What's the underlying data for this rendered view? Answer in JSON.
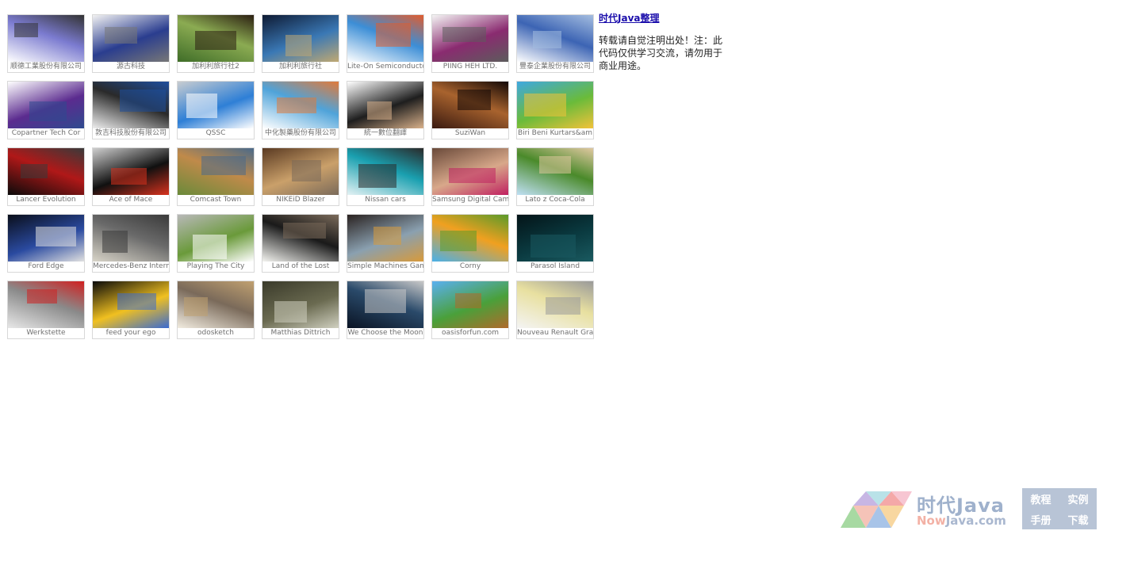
{
  "sidebar": {
    "title": "时代Java整理",
    "note": "转载请自觉注明出处！注：此代码仅供学习交流，请勿用于商业用途。"
  },
  "gallery": [
    {
      "caption": "顺德工業股份有限公司",
      "colors": [
        "#ffffff",
        "#7b7bd0",
        "#333333"
      ]
    },
    {
      "caption": "源古科技",
      "colors": [
        "#f2f2f2",
        "#2a3d8f",
        "#777777"
      ]
    },
    {
      "caption": "加利利旅行社2",
      "colors": [
        "#3f6d28",
        "#8bab52",
        "#2c1f12"
      ]
    },
    {
      "caption": "加利利旅行社",
      "colors": [
        "#0e1a33",
        "#3a78b5",
        "#c0a872"
      ]
    },
    {
      "caption": "Lite-On Semiconducto",
      "colors": [
        "#ffffff",
        "#3c8ed6",
        "#e05c2e"
      ]
    },
    {
      "caption": "PIING HEH LTD.",
      "colors": [
        "#f4f4f4",
        "#8a2b70",
        "#5c5c5c"
      ]
    },
    {
      "caption": "豐泰企業股份有限公司",
      "colors": [
        "#ffffff",
        "#3c64b4",
        "#a4bde0"
      ]
    },
    {
      "caption": "Copartner Tech Cor",
      "colors": [
        "#ffffff",
        "#5b2b8f",
        "#2e4b8f"
      ]
    },
    {
      "caption": "敦吉科技股份有限公司",
      "colors": [
        "#eeeeee",
        "#2a2a2a",
        "#1e4e9c"
      ]
    },
    {
      "caption": "QSSC",
      "colors": [
        "#c8ccd0",
        "#2e7fd6",
        "#ffffff"
      ]
    },
    {
      "caption": "中化製藥股份有限公司",
      "colors": [
        "#ffffff",
        "#4fa3d9",
        "#e07a3a"
      ]
    },
    {
      "caption": "統一數位翻譯",
      "colors": [
        "#ffffff",
        "#1e1e1e",
        "#d8b08a"
      ]
    },
    {
      "caption": "SuziWan",
      "colors": [
        "#3a1a10",
        "#a8632e",
        "#120806"
      ]
    },
    {
      "caption": "Biri Beni Kurtars&am",
      "colors": [
        "#3fa8e0",
        "#6abb3a",
        "#f2c23a"
      ]
    },
    {
      "caption": "Lancer Evolution",
      "colors": [
        "#0a0a0a",
        "#b01818",
        "#3a3a3a"
      ]
    },
    {
      "caption": "Ace of Mace",
      "colors": [
        "#cfcfcf",
        "#101010",
        "#d8321e"
      ]
    },
    {
      "caption": "Comcast Town",
      "colors": [
        "#6a8a3a",
        "#c08a4a",
        "#4a6a8a"
      ]
    },
    {
      "caption": "NIKEiD Blazer",
      "colors": [
        "#5a3a22",
        "#caa06a",
        "#7a6a5a"
      ]
    },
    {
      "caption": "Nissan cars",
      "colors": [
        "#e4f2f4",
        "#1aa0b0",
        "#2a2a2a"
      ]
    },
    {
      "caption": "Samsung Digital Came",
      "colors": [
        "#6a4a3a",
        "#d8a88a",
        "#c02060"
      ]
    },
    {
      "caption": "Lato z Coca-Cola",
      "colors": [
        "#bfe0f4",
        "#4a8a2a",
        "#e0c8a0"
      ]
    },
    {
      "caption": "Ford Edge",
      "colors": [
        "#0a0e1a",
        "#2a4aa0",
        "#e0e0e0"
      ]
    },
    {
      "caption": "Mercedes-Benz Intern",
      "colors": [
        "#d8d4c8",
        "#6a6a6a",
        "#3a3a3a"
      ]
    },
    {
      "caption": "Playing The City",
      "colors": [
        "#b8b8b8",
        "#6a9a3a",
        "#ffffff"
      ]
    },
    {
      "caption": "Land of the Lost",
      "colors": [
        "#f4f4f0",
        "#1a1a1a",
        "#7a6a5a"
      ]
    },
    {
      "caption": "Simple Machines Game",
      "colors": [
        "#2a2220",
        "#8aa0b0",
        "#d89a3a"
      ]
    },
    {
      "caption": "Corny",
      "colors": [
        "#4ab0e8",
        "#f0a020",
        "#5a9a2a"
      ]
    },
    {
      "caption": "Parasol Island",
      "colors": [
        "#041418",
        "#0a3a40",
        "#1a5a60"
      ]
    },
    {
      "caption": "Werkstette",
      "colors": [
        "#e8e8e8",
        "#8a8a8a",
        "#d02020"
      ]
    },
    {
      "caption": "feed your ego",
      "colors": [
        "#0a0a0a",
        "#f0c020",
        "#3a6ad0"
      ]
    },
    {
      "caption": "odosketch",
      "colors": [
        "#f2ece0",
        "#7a6a5a",
        "#c0a070"
      ]
    },
    {
      "caption": "Matthias Dittrich",
      "colors": [
        "#3a3a2a",
        "#6a6a50",
        "#d0d0c0"
      ]
    },
    {
      "caption": "We Choose the Moon",
      "colors": [
        "#0a1424",
        "#2a4a6a",
        "#c8c8c8"
      ]
    },
    {
      "caption": "oasisforfun.com",
      "colors": [
        "#5ab0f0",
        "#4aa03a",
        "#b06a2a"
      ]
    },
    {
      "caption": "Nouveau Renault Gran",
      "colors": [
        "#f4f4f4",
        "#e8e0a0",
        "#9a9a9a"
      ]
    }
  ],
  "watermark": {
    "brand_cn": "时代Java",
    "brand_en_a": "Now",
    "brand_en_b": "Java.com",
    "links": [
      "教程",
      "实例",
      "手册",
      "下载"
    ]
  }
}
